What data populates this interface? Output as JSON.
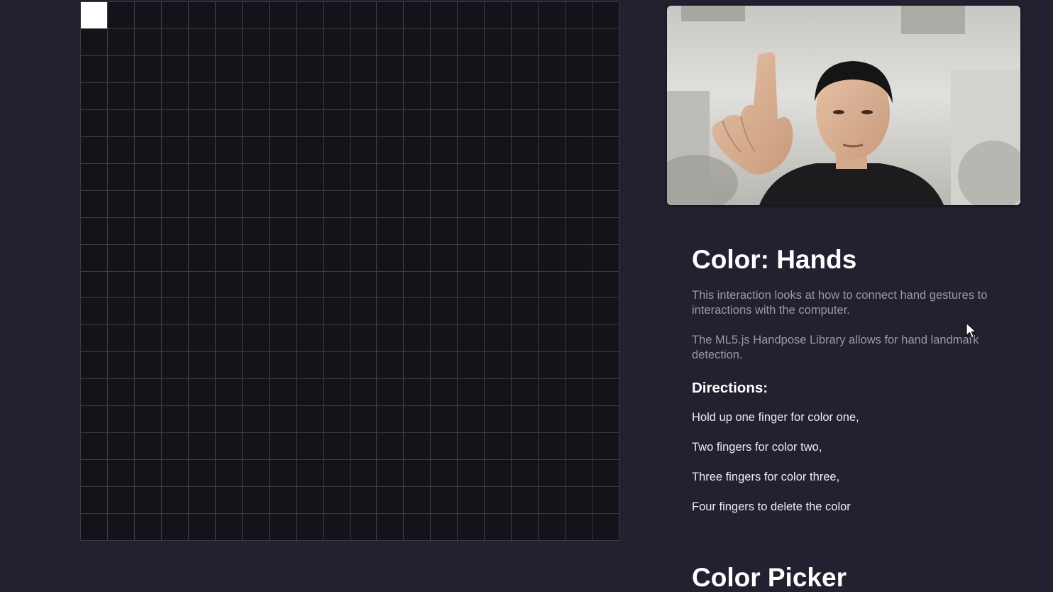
{
  "canvas": {
    "rows": 20,
    "cols": 20,
    "filled_cells": [
      {
        "row": 0,
        "col": 0,
        "color": "#ffffff"
      }
    ],
    "grid_line_color": "#3b3b44",
    "cell_background": "#141319"
  },
  "webcam": {
    "subject": "person holding up one finger"
  },
  "info": {
    "title": "Color: Hands",
    "description_1": "This interaction looks at how to connect hand gestures to interactions with the computer.",
    "description_2": "The ML5.js Handpose Library allows for hand landmark detection.",
    "directions_heading": "Directions:",
    "directions": [
      "Hold up one finger for color one,",
      "Two fingers for color two,",
      "Three fingers for color three,",
      "Four fingers to delete the color"
    ]
  },
  "color_picker": {
    "title": "Color Picker"
  },
  "icons": {
    "cursor": "mouse-pointer-icon"
  },
  "colors": {
    "background": "#21212f",
    "heading": "#ffffff",
    "muted_text": "#9a9aa4",
    "body_text": "#ececf0"
  }
}
